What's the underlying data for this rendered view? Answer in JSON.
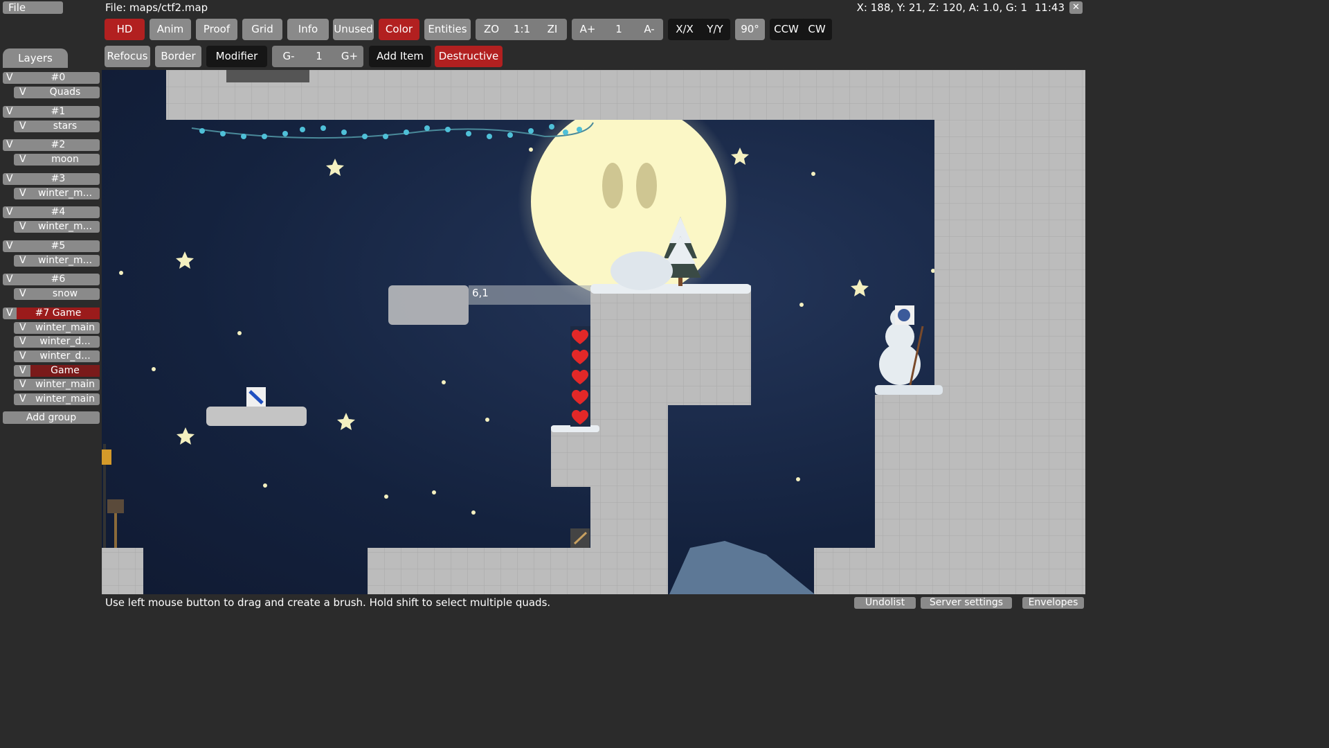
{
  "topbar": {
    "file_menu": "File",
    "file_title": "File: maps/ctf2.map",
    "coords": "X: 188, Y: 21, Z: 120, A: 1.0, G: 1",
    "clock": "11:43",
    "close": "✕"
  },
  "toolbar_row1": {
    "hd": "HD",
    "anim": "Anim",
    "proof": "Proof",
    "grid": "Grid",
    "info": "Info",
    "unused": "Unused",
    "color": "Color",
    "entities": "Entities",
    "zo": "ZO",
    "zoom_reset": "1:1",
    "zi": "ZI",
    "a_plus": "A+",
    "a_value": "1",
    "a_minus": "A-",
    "flip_x": "X/X",
    "flip_y": "Y/Y",
    "rot90": "90°",
    "ccw": "CCW",
    "cw": "CW"
  },
  "toolbar_row2": {
    "refocus": "Refocus",
    "border": "Border",
    "modifier": "Modifier",
    "g_minus": "G-",
    "g_value": "1",
    "g_plus": "G+",
    "add_item": "Add Item",
    "destructive": "Destructive"
  },
  "sidebar": {
    "tab": "Layers",
    "visible_mark": "V",
    "groups": [
      {
        "name": "#0",
        "layers": [
          "Quads"
        ]
      },
      {
        "name": "#1",
        "layers": [
          "stars"
        ]
      },
      {
        "name": "#2",
        "layers": [
          "moon"
        ]
      },
      {
        "name": "#3",
        "layers": [
          "winter_m..."
        ]
      },
      {
        "name": "#4",
        "layers": [
          "winter_m..."
        ]
      },
      {
        "name": "#5",
        "layers": [
          "winter_m..."
        ]
      },
      {
        "name": "#6",
        "layers": [
          "snow"
        ]
      },
      {
        "name": "#7 Game",
        "layers": [
          "winter_main",
          "winter_d...",
          "winter_d...",
          "Game",
          "winter_main",
          "winter_main"
        ]
      }
    ],
    "add_group": "Add group"
  },
  "map": {
    "tile_label": "6,1"
  },
  "statusbar": {
    "hint": "Use left mouse button to drag and create a brush. Hold shift to select multiple quads.",
    "undolist": "Undolist",
    "server_settings": "Server settings",
    "envelopes": "Envelopes"
  },
  "colors": {
    "active_red": "#b22020",
    "button_gray": "#8a8a8a",
    "panel_dark": "#2b2b2b",
    "sky": "#14223e",
    "moon": "#fbf7c6",
    "tile": "#bdbdbd"
  }
}
